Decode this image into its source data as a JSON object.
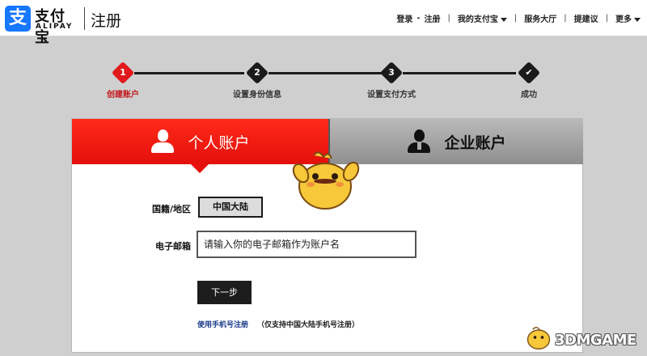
{
  "header": {
    "logo_cn": "支付宝",
    "logo_en": "ALIPAY",
    "logo_mark": "支",
    "page_title": "注册",
    "nav": {
      "login": "登录",
      "register": "注册",
      "my_alipay": "我的支付宝",
      "service_hall": "服务大厅",
      "suggestion": "提建议",
      "more": "更多"
    }
  },
  "steps": [
    {
      "num": "1",
      "label": "创建账户",
      "active": true
    },
    {
      "num": "2",
      "label": "设置身份信息",
      "active": false
    },
    {
      "num": "3",
      "label": "设置支付方式",
      "active": false
    },
    {
      "num": "✔",
      "label": "成功",
      "active": false
    }
  ],
  "tabs": {
    "personal": "个人账户",
    "enterprise": "企业账户"
  },
  "form": {
    "region_label": "国籍/地区",
    "region_value": "中国大陆",
    "email_label": "电子邮箱",
    "email_placeholder": "请输入你的电子邮箱作为账户名",
    "next_button": "下一步",
    "phone_link": "使用手机号注册",
    "phone_note": "（仅支持中国大陆手机号注册）"
  },
  "watermark": "3DMGAME",
  "colors": {
    "accent_red": "#e40f0c",
    "step_dark": "#1a1a1a",
    "link_blue": "#1a3a8a",
    "alipay_blue": "#1677ff"
  }
}
